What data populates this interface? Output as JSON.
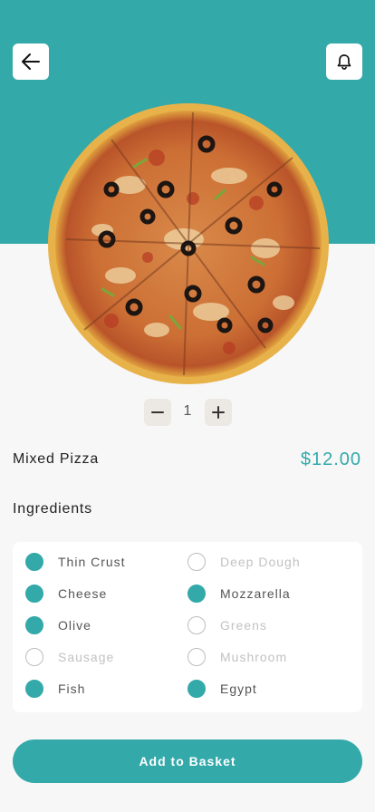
{
  "header": {
    "back_icon": "arrow-left-icon",
    "notification_icon": "bell-icon",
    "accent_color": "#33a9a9"
  },
  "product": {
    "image_icon": "pizza-image",
    "name": "Mixed Pizza",
    "price": "$12.00",
    "quantity": "1"
  },
  "ingredients": {
    "title": "Ingredients",
    "items": [
      {
        "label": "Thin Crust",
        "selected": true
      },
      {
        "label": "Deep Dough",
        "selected": false
      },
      {
        "label": "Cheese",
        "selected": true
      },
      {
        "label": "Mozzarella",
        "selected": true
      },
      {
        "label": "Olive",
        "selected": true
      },
      {
        "label": "Greens",
        "selected": false
      },
      {
        "label": "Sausage",
        "selected": false
      },
      {
        "label": "Mushroom",
        "selected": false
      },
      {
        "label": "Fish",
        "selected": true
      },
      {
        "label": "Egypt",
        "selected": true
      }
    ]
  },
  "actions": {
    "add_to_basket": "Add to Basket"
  }
}
